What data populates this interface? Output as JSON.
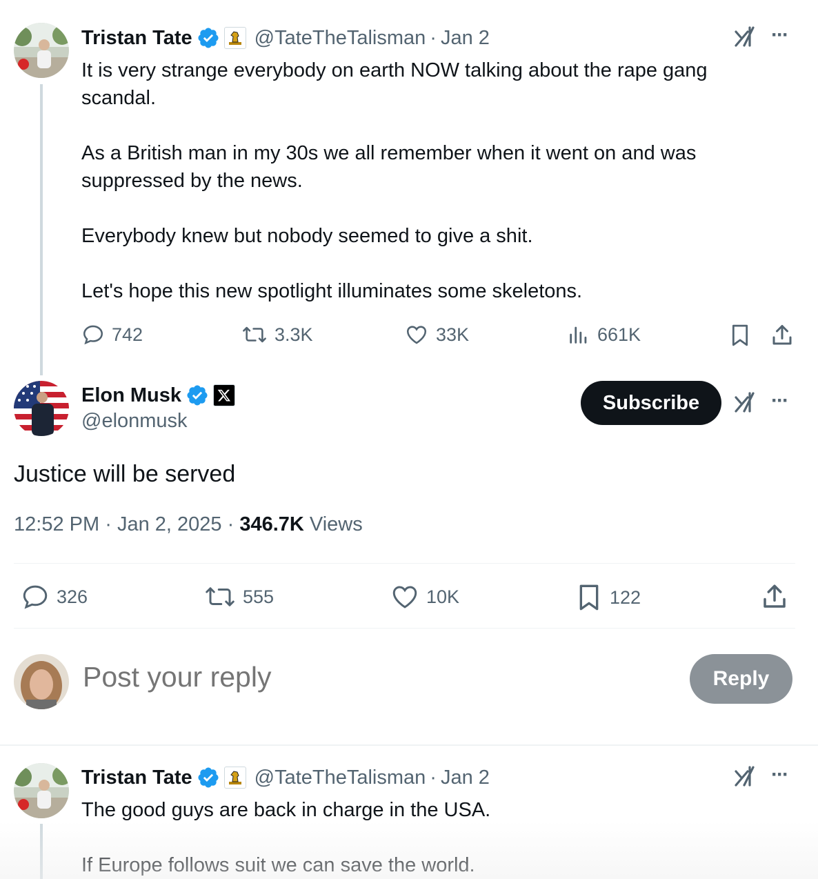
{
  "tweet1": {
    "name": "Tristan Tate",
    "handle": "@TateTheTalisman",
    "separator": "·",
    "date": "Jan 2",
    "text": "It is very strange everybody on earth NOW talking about the rape gang scandal.\n\nAs a British man in my 30s we all remember when it went on and was suppressed by the news.\n\nEverybody knew but nobody seemed to give a shit.\n\nLet's hope this new spotlight illuminates some skeletons.",
    "replies": "742",
    "reposts": "3.3K",
    "likes": "33K",
    "views": "661K"
  },
  "main_tweet": {
    "name": "Elon Musk",
    "handle": "@elonmusk",
    "subscribe_label": "Subscribe",
    "text": "Justice will be served",
    "time": "12:52 PM",
    "separator": "·",
    "date": "Jan 2, 2025",
    "views_count": "346.7K",
    "views_label": "Views",
    "replies": "326",
    "reposts": "555",
    "likes": "10K",
    "bookmarks": "122"
  },
  "reply_box": {
    "placeholder": "Post your reply",
    "button_label": "Reply"
  },
  "tweet3": {
    "name": "Tristan Tate",
    "handle": "@TateTheTalisman",
    "separator": "·",
    "date": "Jan 2",
    "text": "The good guys are back in charge in the USA.\n\nIf Europe follows suit we can save the world."
  },
  "more_label": "···",
  "colors": {
    "verified": "#1d9bf0",
    "text": "#0f1419",
    "secondary": "#536471",
    "subscribe_bg": "#0f1419",
    "reply_btn_bg": "#8b9298"
  }
}
